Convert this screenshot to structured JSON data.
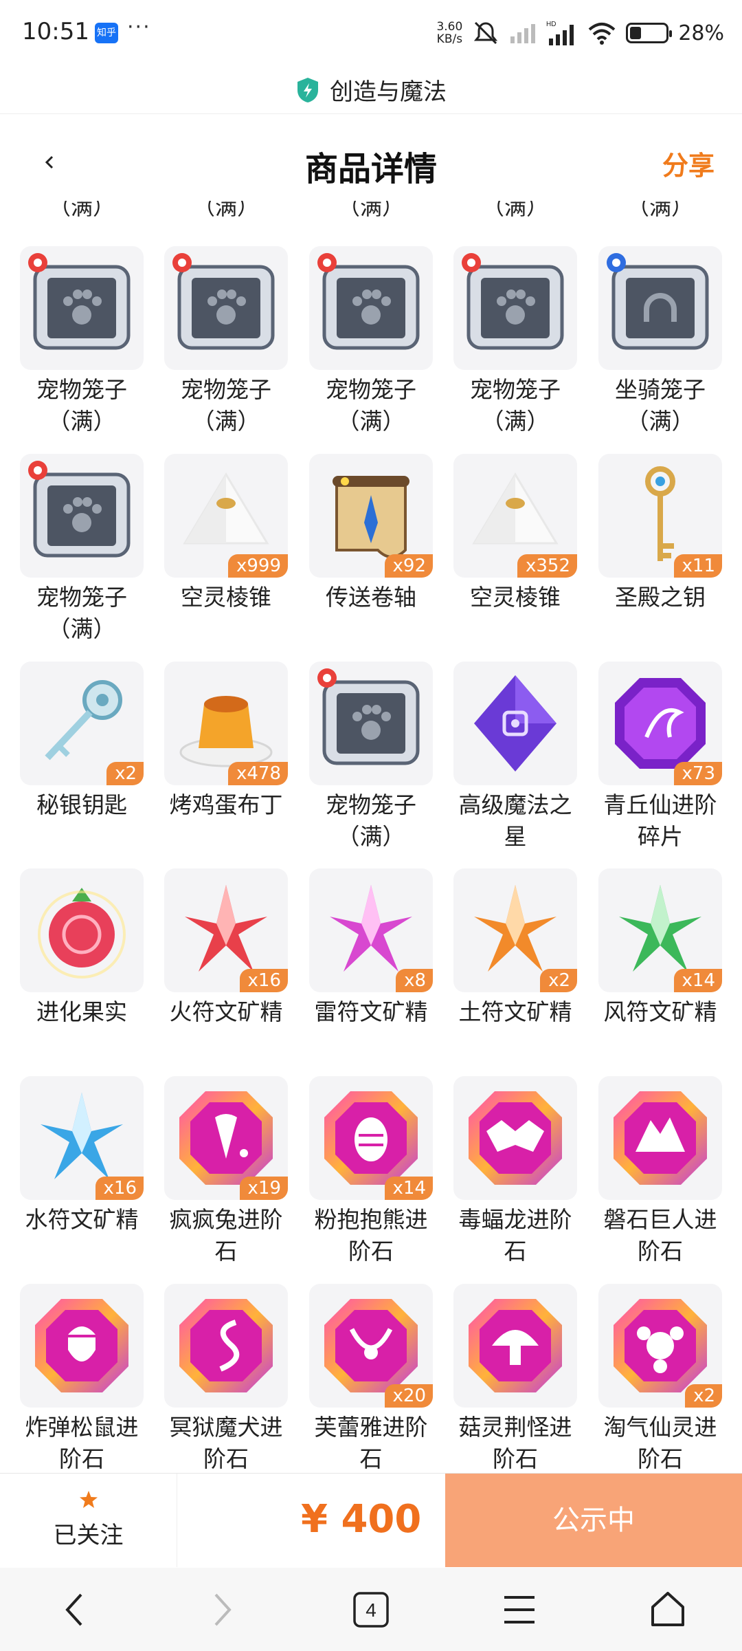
{
  "status_bar": {
    "time": "10:51",
    "badge": "知乎",
    "dots": "···",
    "net_speed_value": "3.60",
    "net_speed_unit": "KB/s",
    "battery": "28%",
    "battery_level": 0.28
  },
  "app": {
    "title": "创造与魔法",
    "icon": "shield-icon"
  },
  "header": {
    "title": "商品详情",
    "share": "分享",
    "accent_color": "#f07b1c"
  },
  "partial_row": [
    "（满）",
    "（满）",
    "（满）",
    "（满）",
    "（满）"
  ],
  "items": [
    {
      "name": "宠物笼子\n（满）",
      "icon": "pet-cage-icon",
      "qty": ""
    },
    {
      "name": "宠物笼子\n（满）",
      "icon": "pet-cage-icon",
      "qty": ""
    },
    {
      "name": "宠物笼子\n（满）",
      "icon": "pet-cage-icon",
      "qty": ""
    },
    {
      "name": "宠物笼子\n（满）",
      "icon": "pet-cage-icon",
      "qty": ""
    },
    {
      "name": "坐骑笼子\n（满）",
      "icon": "mount-cage-icon",
      "qty": ""
    },
    {
      "name": "宠物笼子\n（满）",
      "icon": "pet-cage-icon",
      "qty": ""
    },
    {
      "name": "空灵棱锥",
      "icon": "pyramid-icon",
      "qty": "x999"
    },
    {
      "name": "传送卷轴",
      "icon": "scroll-icon",
      "qty": "x92"
    },
    {
      "name": "空灵棱锥",
      "icon": "pyramid-icon",
      "qty": "x352"
    },
    {
      "name": "圣殿之钥",
      "icon": "temple-key-icon",
      "qty": "x11"
    },
    {
      "name": "秘银钥匙",
      "icon": "silver-key-icon",
      "qty": "x2"
    },
    {
      "name": "烤鸡蛋布丁",
      "icon": "pudding-icon",
      "qty": "x478"
    },
    {
      "name": "宠物笼子\n（满）",
      "icon": "pet-cage-icon",
      "qty": ""
    },
    {
      "name": "高级魔法之\n星",
      "icon": "magic-star-icon",
      "qty": ""
    },
    {
      "name": "青丘仙进阶\n碎片",
      "icon": "purple-gem-icon",
      "qty": "x73"
    },
    {
      "name": "进化果实",
      "icon": "evolution-fruit-icon",
      "qty": ""
    },
    {
      "name": "火符文矿精",
      "icon": "fire-crystal-icon",
      "qty": "x16"
    },
    {
      "name": "雷符文矿精",
      "icon": "thunder-crystal-icon",
      "qty": "x8"
    },
    {
      "name": "土符文矿精",
      "icon": "earth-crystal-icon",
      "qty": "x2"
    },
    {
      "name": "风符文矿精",
      "icon": "wind-crystal-icon",
      "qty": "x14"
    },
    {
      "name": "水符文矿精",
      "icon": "water-crystal-icon",
      "qty": "x16"
    },
    {
      "name": "疯疯兔进阶\n石",
      "icon": "rabbit-stone-icon",
      "qty": "x19"
    },
    {
      "name": "粉抱抱熊进\n阶石",
      "icon": "bear-stone-icon",
      "qty": "x14"
    },
    {
      "name": "毒蝠龙进阶\n石",
      "icon": "bat-dragon-stone-icon",
      "qty": ""
    },
    {
      "name": "磐石巨人进\n阶石",
      "icon": "giant-stone-icon",
      "qty": ""
    },
    {
      "name": "炸弹松鼠进\n阶石",
      "icon": "squirrel-stone-icon",
      "qty": ""
    },
    {
      "name": "冥狱魔犬进\n阶石",
      "icon": "hellhound-stone-icon",
      "qty": ""
    },
    {
      "name": "芙蕾雅进阶\n石",
      "icon": "freya-stone-icon",
      "qty": "x20"
    },
    {
      "name": "菇灵荆怪进\n阶石",
      "icon": "mushroom-stone-icon",
      "qty": ""
    },
    {
      "name": "淘气仙灵进\n阶石",
      "icon": "fairy-stone-icon",
      "qty": "x2"
    }
  ],
  "bottom": {
    "follow_label": "已关注",
    "price": "¥ 400",
    "status_button": "公示中",
    "price_color": "#f0701e"
  },
  "nav": {
    "back": "back-icon",
    "forward": "forward-icon",
    "tabs_count": "4",
    "menu": "menu-icon",
    "home": "home-icon"
  }
}
